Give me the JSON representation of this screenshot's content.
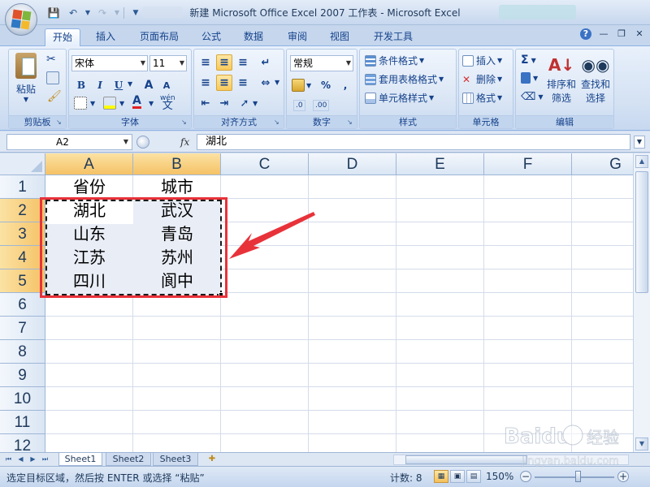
{
  "window": {
    "title": "新建 Microsoft Office Excel 2007 工作表 - Microsoft Excel"
  },
  "tabs": [
    "开始",
    "插入",
    "页面布局",
    "公式",
    "数据",
    "审阅",
    "视图",
    "开发工具"
  ],
  "ribbon": {
    "clipboard": {
      "label": "剪贴板",
      "paste": "粘贴"
    },
    "font": {
      "label": "字体",
      "font_name": "宋体",
      "font_size": "11",
      "bold": "B",
      "italic": "I",
      "underline": "U",
      "grow": "A",
      "shrink": "A",
      "phonetic": "wén",
      "font_color_letter": "A"
    },
    "alignment": {
      "label": "对齐方式"
    },
    "number": {
      "label": "数字",
      "format": "常规",
      "percent": "%",
      "comma": ",",
      "inc_decimal": ".0",
      "dec_decimal": ".00"
    },
    "styles": {
      "label": "样式",
      "conditional": "条件格式",
      "table": "套用表格格式",
      "cell_styles": "单元格样式"
    },
    "cells": {
      "label": "单元格",
      "insert": "插入",
      "delete": "删除",
      "format": "格式"
    },
    "editing": {
      "label": "编辑",
      "sum": "Σ",
      "sort_filter_1": "排序和",
      "sort_filter_2": "筛选",
      "find_1": "查找和",
      "find_2": "选择"
    }
  },
  "formula_bar": {
    "name_box": "A2",
    "fx": "fx",
    "content": "湖北"
  },
  "grid": {
    "columns": [
      "A",
      "B",
      "C",
      "D",
      "E",
      "F",
      "G"
    ],
    "rows": [
      "1",
      "2",
      "3",
      "4",
      "5",
      "6",
      "7",
      "8",
      "9",
      "10",
      "11",
      "12"
    ],
    "cells": {
      "A1": "省份",
      "B1": "城市",
      "A2": "湖北",
      "B2": "武汉",
      "A3": "山东",
      "B3": "青岛",
      "A4": "江苏",
      "B4": "苏州",
      "A5": "四川",
      "B5": "阆中"
    }
  },
  "sheets": [
    "Sheet1",
    "Sheet2",
    "Sheet3"
  ],
  "status": {
    "message": "选定目标区域，然后按 ENTER 或选择 “粘贴”",
    "count": "计数: 8",
    "zoom": "150%"
  },
  "watermark": {
    "brand": "Baidu",
    "sub": "经验",
    "url": "jingyan.baidu.com"
  },
  "colors": {
    "highlight_red": "#e8323a",
    "selected_header": "#f5c266"
  }
}
